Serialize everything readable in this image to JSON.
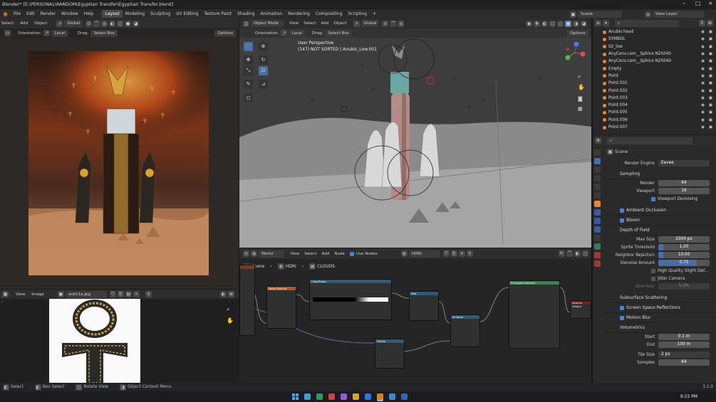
{
  "window": {
    "title": "Blender* [E:\\PERSONAL\\RANDOM\\Egyptian Transfer\\Egyptian Transfer.blend]"
  },
  "menu": [
    "File",
    "Edit",
    "Render",
    "Window",
    "Help"
  ],
  "workspaces": [
    "Layout",
    "Modeling",
    "Sculpting",
    "UV Editing",
    "Texture Paint",
    "Shading",
    "Animation",
    "Rendering",
    "Compositing",
    "Scripting"
  ],
  "active_workspace": "Layout",
  "scene_name": "Scene",
  "view_layer": "View Layer",
  "left_header": {
    "menus": [
      "Select",
      "Add",
      "Object"
    ],
    "transform": "Global",
    "orientation_label": "Orientation:",
    "orientation": "Local",
    "drag_label": "Drag:",
    "drag": "Select Box",
    "options": "Options"
  },
  "viewport": {
    "mode": "Object Mode",
    "menus": [
      "View",
      "Select",
      "Add",
      "Object"
    ],
    "transform": "Global",
    "orientation_label": "Orientation:",
    "orientation": "Local",
    "drag_label": "Drag:",
    "drag": "Select Box",
    "options": "Options",
    "overlay_title": "User Perspective",
    "overlay_subtitle": "(147) NOT SORTED | Anubis_Low.001"
  },
  "node_editor": {
    "world_label": "World",
    "menus": [
      "View",
      "Select",
      "Add",
      "Node"
    ],
    "use_nodes": "Use Nodes",
    "world_name": "HDRI",
    "breadcrumb": [
      "Scene",
      "HDRI",
      "CLOUDS"
    ],
    "nodes": [
      "Noise Texture",
      "ColorRamp",
      "Add",
      "Multiply",
      "Divide",
      "Principled Volume",
      "Volume Output"
    ]
  },
  "image_editor": {
    "menus": [
      "View",
      "Image"
    ],
    "image_name": "ankh1a.jpg"
  },
  "outliner": {
    "items": [
      {
        "name": "Anubis head",
        "color": "#e28a3c"
      },
      {
        "name": "SYMBOL",
        "color": "#e28a3c"
      },
      {
        "name": "02_low",
        "color": "#e28a3c"
      },
      {
        "name": "AnyConv.com__Sphinx N25040",
        "color": "#e28a3c"
      },
      {
        "name": "AnyConv.com__Sphinx N25040",
        "color": "#e28a3c"
      },
      {
        "name": "Empty",
        "color": "#e28a3c"
      },
      {
        "name": "Point",
        "color": "#e28a3c"
      },
      {
        "name": "Point.001",
        "color": "#e28a3c"
      },
      {
        "name": "Point.002",
        "color": "#e28a3c"
      },
      {
        "name": "Point.003",
        "color": "#e28a3c"
      },
      {
        "name": "Point.004",
        "color": "#e28a3c"
      },
      {
        "name": "Point.005",
        "color": "#e28a3c"
      },
      {
        "name": "Point.006",
        "color": "#e28a3c"
      },
      {
        "name": "Point.007",
        "color": "#e28a3c"
      }
    ]
  },
  "properties": {
    "scene": "Scene",
    "render_engine_label": "Render Engine",
    "render_engine": "Eevee",
    "sampling": {
      "title": "Sampling",
      "render_label": "Render",
      "render": "64",
      "viewport_label": "Viewport",
      "viewport": "16",
      "denoise": "Viewport Denoising"
    },
    "ambient_occlusion": "Ambient Occlusion",
    "bloom": "Bloom",
    "dof": {
      "title": "Depth of Field",
      "max_size_label": "Max Size",
      "max_size": "2000 px",
      "sprite_label": "Sprite Threshold",
      "sprite": "1.00",
      "neighbor_label": "Neighbor Rejection",
      "neighbor": "10.00",
      "denoise_label": "Denoise Amount",
      "denoise": "0.75",
      "hq": "High Quality Slight Def...",
      "jitter": "Jitter Camera",
      "overblur_label": "Over-blur",
      "overblur": "5.0%"
    },
    "subsurface": "Subsurface Scattering",
    "ssr": "Screen Space Reflections",
    "motion_blur": "Motion Blur",
    "volumetrics": {
      "title": "Volumetrics",
      "start_label": "Start",
      "start": "0.1 m",
      "end_label": "End",
      "end": "100 m",
      "tile_label": "Tile Size",
      "tile": "2 px",
      "samples_label": "Samples",
      "samples": "64"
    }
  },
  "status": {
    "select": "Select",
    "box_select": "Box Select",
    "rotate": "Rotate View",
    "context": "Object Context Menu",
    "version": "3.1.0"
  },
  "taskbar": {
    "time": "9:22 PM"
  }
}
